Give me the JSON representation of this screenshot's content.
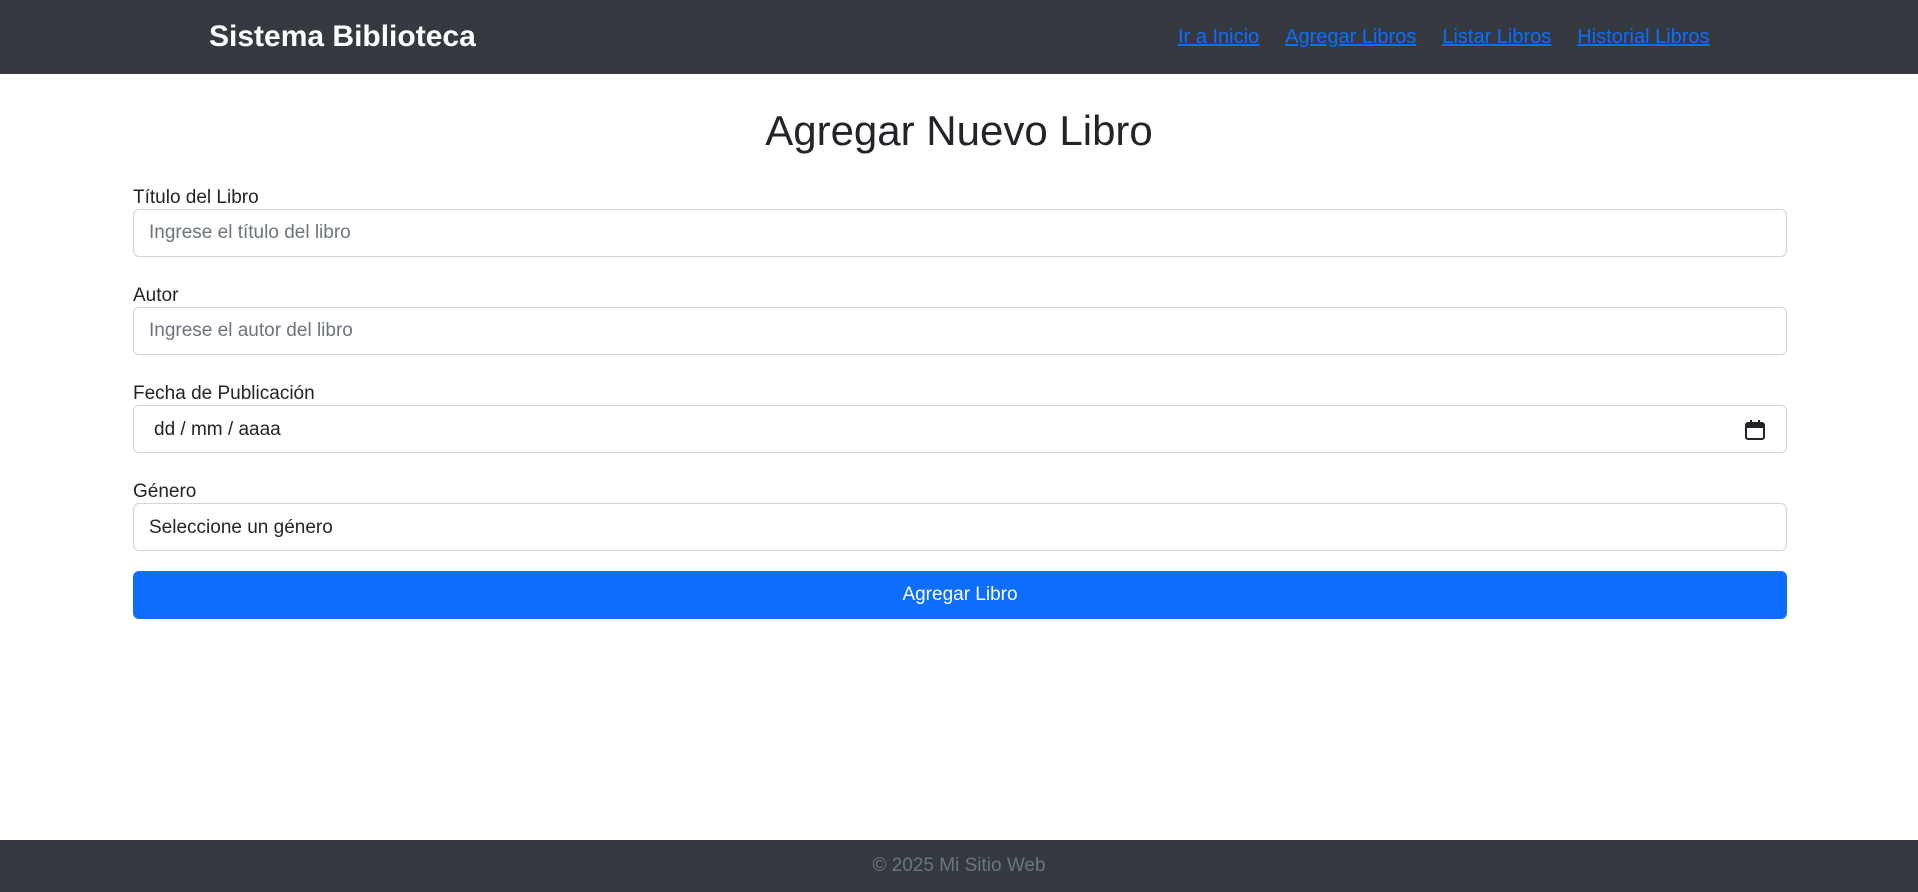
{
  "header": {
    "brand": "Sistema Biblioteca",
    "nav": [
      {
        "label": "Ir a Inicio"
      },
      {
        "label": "Agregar Libros"
      },
      {
        "label": "Listar Libros"
      },
      {
        "label": "Historial Libros"
      }
    ]
  },
  "main": {
    "title": "Agregar Nuevo Libro",
    "form": {
      "title_field": {
        "label": "Título del Libro",
        "placeholder": "Ingrese el título del libro",
        "value": ""
      },
      "author_field": {
        "label": "Autor",
        "placeholder": "Ingrese el autor del libro",
        "value": ""
      },
      "date_field": {
        "label": "Fecha de Publicación",
        "display": "dd / mm / aaaa",
        "icon": "calendar-icon"
      },
      "genre_field": {
        "label": "Género",
        "selected": "Seleccione un género"
      },
      "submit_label": "Agregar Libro"
    }
  },
  "footer": {
    "text": "© 2025 Mi Sitio Web"
  },
  "colors": {
    "navbar_bg": "#343a40",
    "link": "#0d6efd",
    "primary": "#0d6efd",
    "footer_text": "#6c757d"
  }
}
